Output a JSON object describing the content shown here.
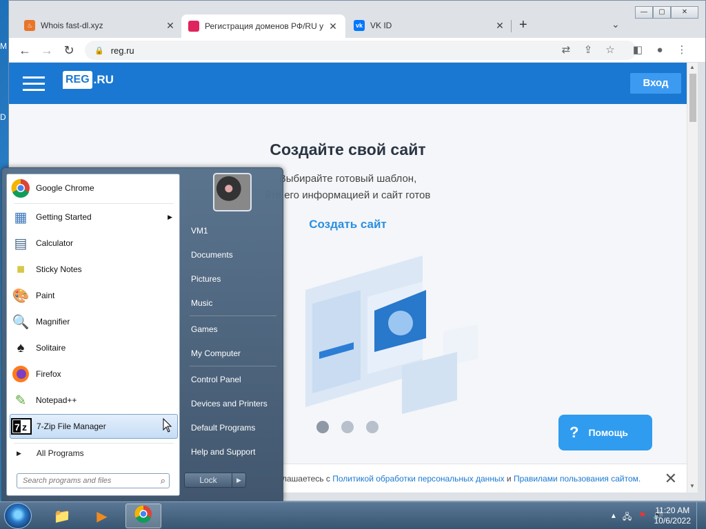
{
  "desktop": {
    "labels": [
      "M",
      "D"
    ]
  },
  "browser": {
    "tabs": [
      {
        "title": "Whois fast-dl.xyz",
        "icon": "fire-icon",
        "active": false
      },
      {
        "title": "Регистрация доменов РФ/RU у",
        "icon": "regru-icon",
        "active": true
      },
      {
        "title": "VK ID",
        "icon": "vk-icon",
        "active": false
      }
    ],
    "address": "reg.ru",
    "window_buttons": {
      "minimize": "—",
      "maximize": "▢",
      "close": "✕"
    }
  },
  "site": {
    "logo_box": "REG",
    "logo_rest": ".RU",
    "login": "Вход",
    "hero_title": "Создайте свой сайт",
    "hero_sub_1": "Выбирайте готовый шаблон,",
    "hero_sub_2": "йте его информацией и сайт готов",
    "create_link": "Создать сайт",
    "help": "Помощь",
    "help_glyph": "?",
    "cookie": {
      "prefix": "лашаетесь с",
      "link1": "Политикой обработки персональных данных",
      "mid": "и",
      "link2": "Правилами пользования сайтом."
    }
  },
  "start_menu": {
    "programs": [
      {
        "label": "Google Chrome",
        "icon": "chrome-icon",
        "submenu": false
      },
      {
        "label": "Getting Started",
        "icon": "getting-started-icon",
        "submenu": true
      },
      {
        "label": "Calculator",
        "icon": "calculator-icon",
        "submenu": false
      },
      {
        "label": "Sticky Notes",
        "icon": "sticky-notes-icon",
        "submenu": false
      },
      {
        "label": "Paint",
        "icon": "paint-icon",
        "submenu": false
      },
      {
        "label": "Magnifier",
        "icon": "magnifier-icon",
        "submenu": false
      },
      {
        "label": "Solitaire",
        "icon": "solitaire-icon",
        "submenu": false
      },
      {
        "label": "Firefox",
        "icon": "firefox-icon",
        "submenu": false
      },
      {
        "label": "Notepad++",
        "icon": "notepadpp-icon",
        "submenu": false
      },
      {
        "label": "7-Zip File Manager",
        "icon": "7zip-icon",
        "submenu": false,
        "highlighted": true
      }
    ],
    "all_programs": "All Programs",
    "search_placeholder": "Search programs and files",
    "right": [
      "VM1",
      "Documents",
      "Pictures",
      "Music",
      "Games",
      "My Computer",
      "Control Panel",
      "Devices and Printers",
      "Default Programs",
      "Help and Support"
    ],
    "lock": "Lock"
  },
  "taskbar": {
    "pinned": [
      {
        "name": "explorer",
        "icon": "folder-icon",
        "active": false
      },
      {
        "name": "media-player",
        "icon": "media-player-icon",
        "active": false
      },
      {
        "name": "chrome",
        "icon": "chrome-icon",
        "active": true
      }
    ],
    "time": "11:20 AM",
    "date": "10/6/2022"
  }
}
